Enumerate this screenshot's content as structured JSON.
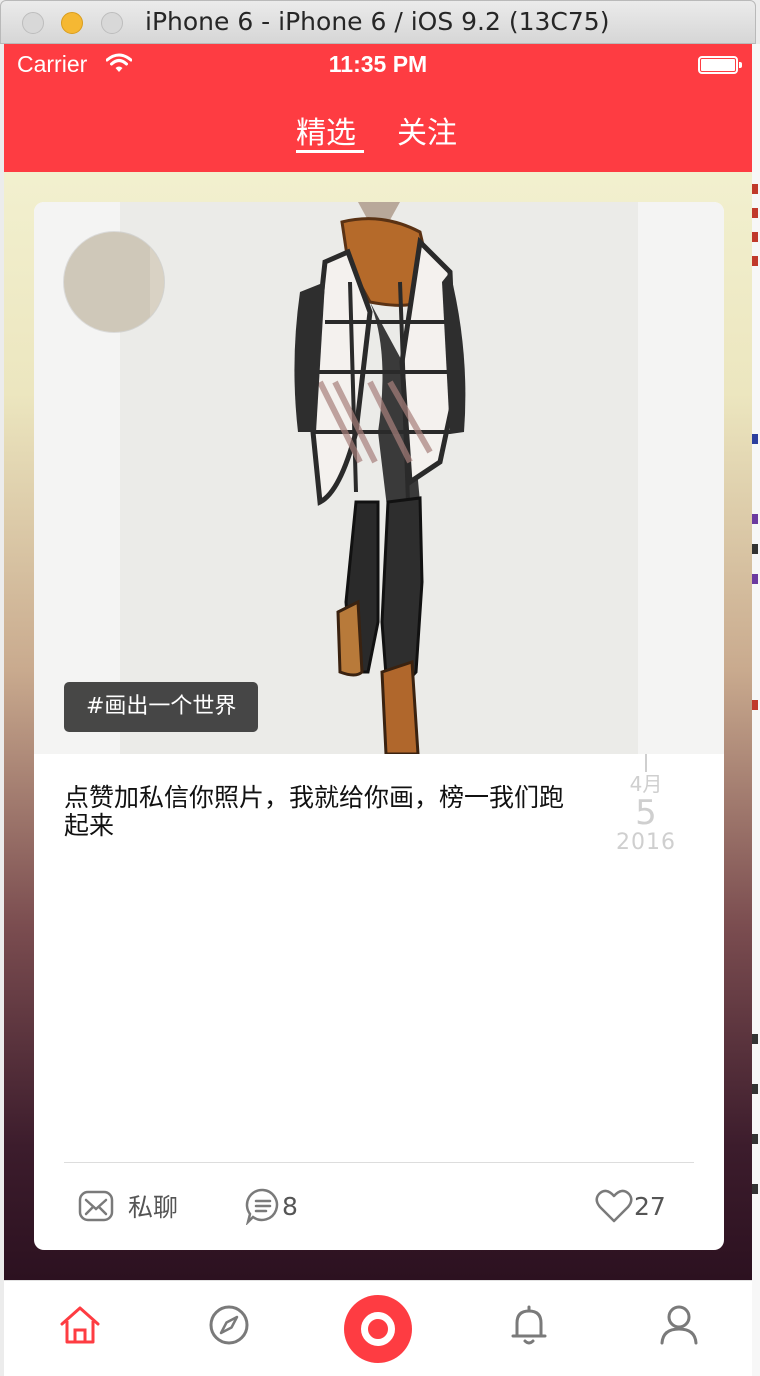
{
  "window": {
    "title": "iPhone 6 - iPhone 6 / iOS 9.2 (13C75)"
  },
  "status_bar": {
    "carrier": "Carrier",
    "time": "11:35 PM"
  },
  "nav": {
    "tabs": [
      {
        "label": "精选",
        "active": true
      },
      {
        "label": "关注",
        "active": false
      }
    ]
  },
  "post": {
    "tag": "#画出一个世界",
    "caption": "点赞加私信你照片，我就给你画，榜一我们跑起来",
    "date": {
      "month": "4月",
      "day": "5",
      "year": "2016"
    },
    "actions": {
      "message_label": "私聊",
      "comment_count": "8",
      "like_count": "27"
    }
  },
  "tab_bar": {
    "items": [
      "home-icon",
      "compass-icon",
      "record-button",
      "bell-icon",
      "profile-icon"
    ],
    "active": "home-icon"
  },
  "colors": {
    "accent": "#fe3c42",
    "tab_icon_inactive": "#7a7a7a"
  }
}
